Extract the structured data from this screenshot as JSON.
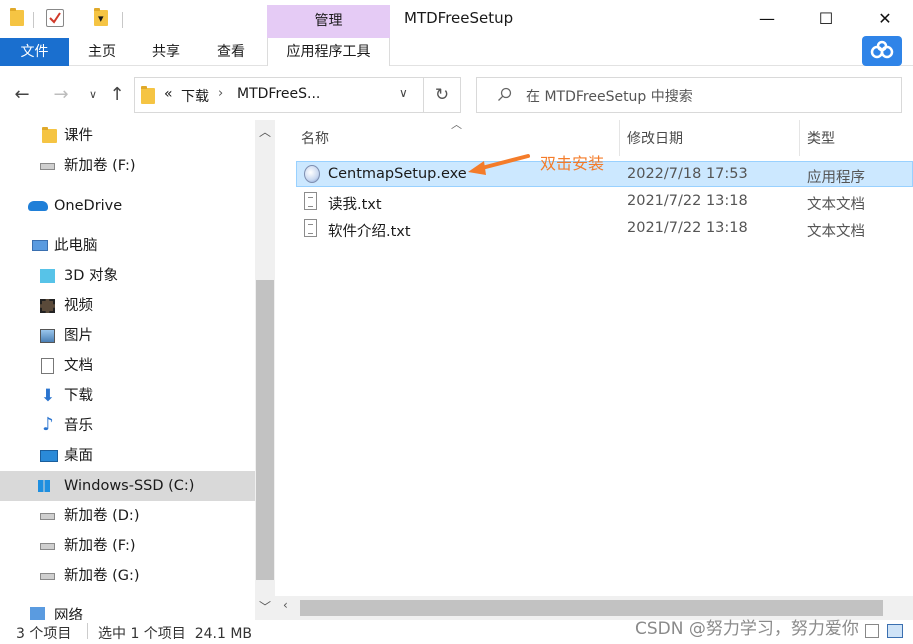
{
  "titlebar": {
    "window_title": "MTDFreeSetup",
    "manage_tab": "管理",
    "minimize": "—",
    "maximize": "☐",
    "close": "✕"
  },
  "ribbon": {
    "tabs": [
      {
        "label": "文件"
      },
      {
        "label": "主页"
      },
      {
        "label": "共享"
      },
      {
        "label": "查看"
      },
      {
        "label": "应用程序工具"
      }
    ]
  },
  "address": {
    "overflow": "«",
    "crumbs": [
      "下载",
      "MTDFreeS..."
    ],
    "search_placeholder": "在 MTDFreeSetup 中搜索"
  },
  "nav": {
    "items": [
      {
        "label": "课件",
        "icon": "folder-icon"
      },
      {
        "label": "新加卷 (F:)",
        "icon": "drive-icon"
      },
      {
        "label": "OneDrive",
        "icon": "cloud-icon"
      },
      {
        "label": "此电脑",
        "icon": "computer-icon"
      },
      {
        "label": "3D 对象",
        "icon": "cube-icon"
      },
      {
        "label": "视频",
        "icon": "video-icon"
      },
      {
        "label": "图片",
        "icon": "picture-icon"
      },
      {
        "label": "文档",
        "icon": "document-icon"
      },
      {
        "label": "下载",
        "icon": "download-icon"
      },
      {
        "label": "音乐",
        "icon": "music-icon"
      },
      {
        "label": "桌面",
        "icon": "desktop-icon"
      },
      {
        "label": "Windows-SSD (C:)",
        "icon": "windows-drive-icon",
        "selected": true
      },
      {
        "label": "新加卷 (D:)",
        "icon": "drive-icon"
      },
      {
        "label": "新加卷 (F:)",
        "icon": "drive-icon"
      },
      {
        "label": "新加卷 (G:)",
        "icon": "drive-icon"
      },
      {
        "label": "网络",
        "icon": "network-icon"
      }
    ]
  },
  "columns": {
    "name": "名称",
    "modified": "修改日期",
    "type": "类型"
  },
  "files": [
    {
      "name": "CentmapSetup.exe",
      "modified": "2022/7/18 17:53",
      "type": "应用程序",
      "icon": "exe-icon",
      "selected": true
    },
    {
      "name": "读我.txt",
      "modified": "2021/7/22 13:18",
      "type": "文本文档",
      "icon": "text-file-icon"
    },
    {
      "name": "软件介绍.txt",
      "modified": "2021/7/22 13:18",
      "type": "文本文档",
      "icon": "text-file-icon"
    }
  ],
  "annotation": {
    "text": "双击安装",
    "color": "#f47c2a"
  },
  "status": {
    "count": "3 个项目",
    "selection": "选中 1 个项目  24.1 MB"
  },
  "watermark": "CSDN @努力学习，努力爱你",
  "colors": {
    "accent": "#1a6fcf",
    "manage_tab": "#e5cbf5",
    "selection": "#cce8ff"
  }
}
